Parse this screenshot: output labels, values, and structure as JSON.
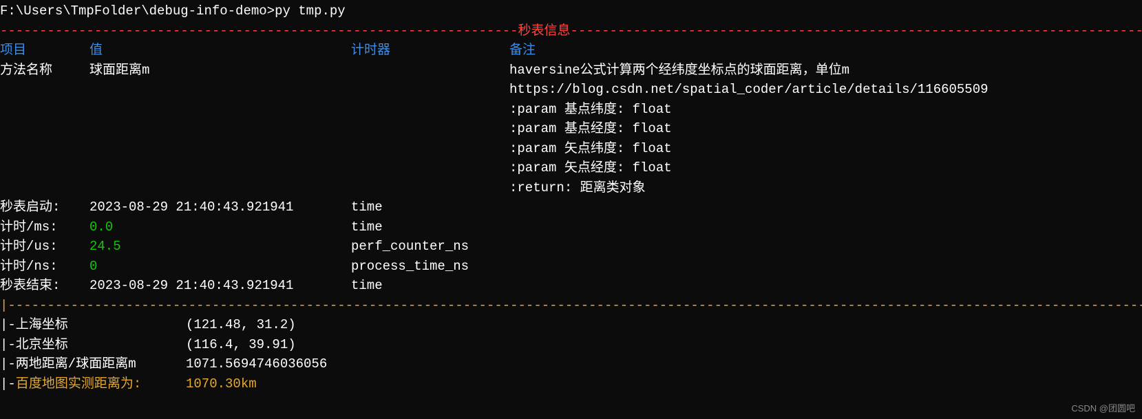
{
  "prompt": "F:\\Users\\TmpFolder\\debug-info-demo>py tmp.py",
  "section_title": "秒表信息",
  "headers": {
    "col1": "项目",
    "col2": "值",
    "col3": "计时器",
    "col4": "备注"
  },
  "method_row": {
    "label": "方法名称",
    "value": "球面距离m"
  },
  "remarks": [
    "haversine公式计算两个经纬度坐标点的球面距离，单位m",
    "https://blog.csdn.net/spatial_coder/article/details/116605509",
    ":param 基点纬度: float",
    ":param 基点经度: float",
    ":param 矢点纬度: float",
    ":param 矢点经度: float",
    ":return: 距离类对象"
  ],
  "timing": [
    {
      "label": "秒表启动:",
      "value": "2023-08-29 21:40:43.921941",
      "timer": "time",
      "green": false
    },
    {
      "label": "计时/ms:",
      "value": "0.0",
      "timer": "time",
      "green": true
    },
    {
      "label": "计时/us:",
      "value": "24.5",
      "timer": "perf_counter_ns",
      "green": true
    },
    {
      "label": "计时/ns:",
      "value": "0",
      "timer": "process_time_ns",
      "green": true
    },
    {
      "label": "秒表结束:",
      "value": "2023-08-29 21:40:43.921941",
      "timer": "time",
      "green": false
    }
  ],
  "coords": [
    {
      "label": "|-上海坐标",
      "value": "(121.48, 31.2)",
      "yellow": false
    },
    {
      "label": "|-北京坐标",
      "value": "(116.4, 39.91)",
      "yellow": false
    },
    {
      "label": "|-两地距离/球面距离m",
      "value": "1071.5694746036056",
      "yellow": false
    },
    {
      "label": "|-百度地图实测距离为:",
      "value": "1070.30km",
      "yellow": true
    }
  ],
  "watermark": "CSDN @团圆吧"
}
